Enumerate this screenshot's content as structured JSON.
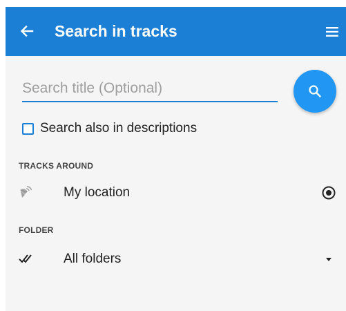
{
  "appbar": {
    "title": "Search in tracks",
    "back_icon": "arrow-left-icon",
    "menu_icon": "hamburger-menu-icon",
    "color": "#1c7fd6"
  },
  "search": {
    "placeholder": "Search title (Optional)",
    "value": "",
    "button_icon": "search-icon",
    "button_color": "#2196f3"
  },
  "options": {
    "search_descriptions_label": "Search also in descriptions",
    "search_descriptions_checked": false
  },
  "tracks_around": {
    "header": "TRACKS AROUND",
    "value": "My location",
    "icon": "gps-signal-icon",
    "action_icon": "radio-target-icon"
  },
  "folder": {
    "header": "FOLDER",
    "value": "All folders",
    "icon": "double-check-icon",
    "action_icon": "dropdown-arrow-icon"
  }
}
